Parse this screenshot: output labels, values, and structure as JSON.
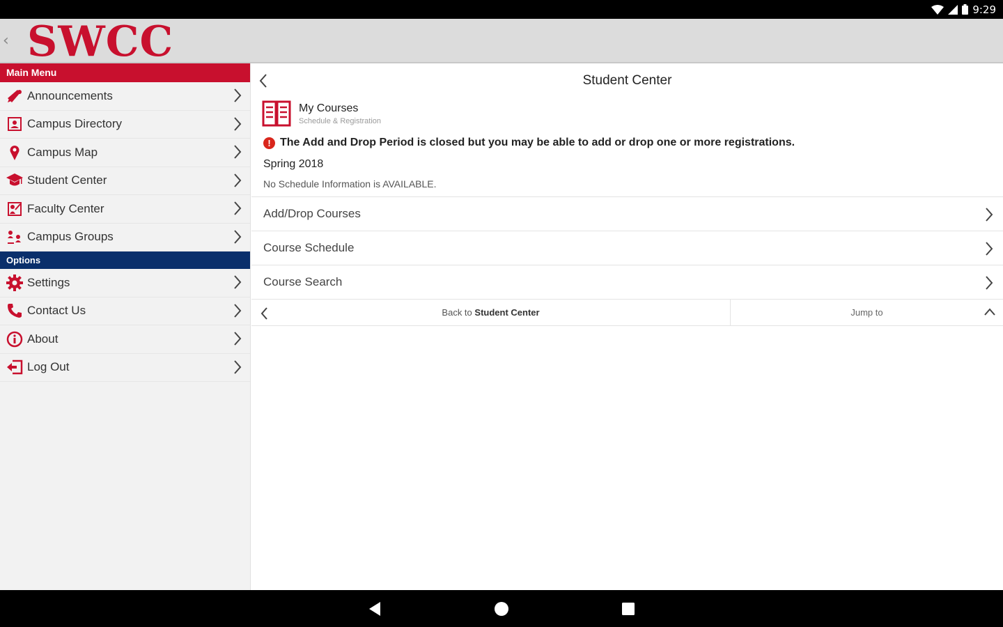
{
  "status_bar": {
    "time": "9:29"
  },
  "header": {
    "logo_text": "SWCC",
    "brand_color": "#c8102e"
  },
  "sidebar": {
    "main_menu_label": "Main Menu",
    "main_items": [
      {
        "label": "Announcements",
        "icon": "megaphone-icon"
      },
      {
        "label": "Campus Directory",
        "icon": "contact-card-icon"
      },
      {
        "label": "Campus Map",
        "icon": "map-pin-icon"
      },
      {
        "label": "Student Center",
        "icon": "graduation-cap-icon"
      },
      {
        "label": "Faculty Center",
        "icon": "faculty-icon"
      },
      {
        "label": "Campus Groups",
        "icon": "groups-icon"
      }
    ],
    "options_label": "Options",
    "option_items": [
      {
        "label": "Settings",
        "icon": "gear-icon"
      },
      {
        "label": "Contact Us",
        "icon": "phone-icon"
      },
      {
        "label": "About",
        "icon": "info-icon"
      },
      {
        "label": "Log Out",
        "icon": "logout-icon"
      }
    ]
  },
  "main": {
    "title": "Student Center",
    "course": {
      "title": "My Courses",
      "subtitle": "Schedule & Registration"
    },
    "warning": "The Add and Drop Period is closed but you may be able to add or drop one or more registrations.",
    "term": "Spring 2018",
    "no_schedule": "No Schedule Information is AVAILABLE.",
    "actions": [
      {
        "label": "Add/Drop Courses"
      },
      {
        "label": "Course Schedule"
      },
      {
        "label": "Course Search"
      }
    ],
    "bottom_nav": {
      "back_prefix": "Back to",
      "back_target": "Student Center",
      "jump_label": "Jump to"
    }
  },
  "colors": {
    "accent_red": "#c8102e",
    "options_blue": "#0a2f6b",
    "warning_red": "#d9261c"
  }
}
